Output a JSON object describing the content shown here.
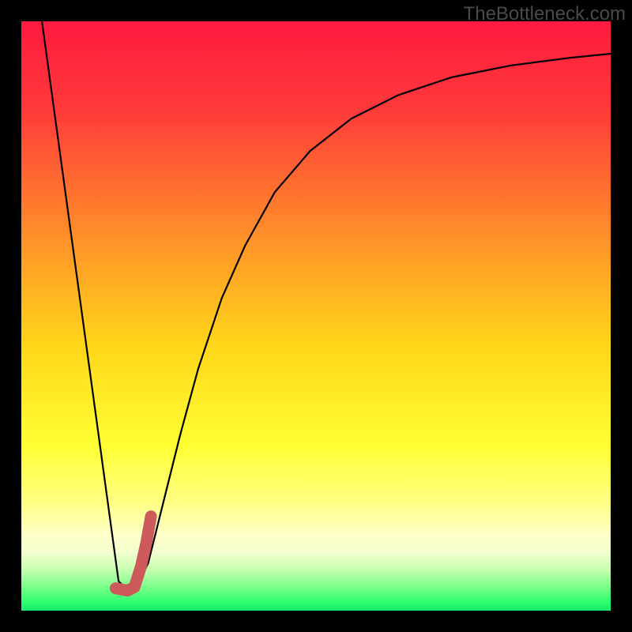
{
  "watermark": "TheBottleneck.com",
  "chart_data": {
    "type": "line",
    "title": "",
    "xlabel": "",
    "ylabel": "",
    "xlim": [
      0,
      100
    ],
    "ylim": [
      0,
      100
    ],
    "gradient_stops": [
      {
        "offset": 0,
        "color": "#ff1a3f"
      },
      {
        "offset": 0.15,
        "color": "#ff3a3a"
      },
      {
        "offset": 0.35,
        "color": "#ff8a2a"
      },
      {
        "offset": 0.55,
        "color": "#ffd61a"
      },
      {
        "offset": 0.72,
        "color": "#ffff33"
      },
      {
        "offset": 0.82,
        "color": "#ffff88"
      },
      {
        "offset": 0.87,
        "color": "#ffffc8"
      },
      {
        "offset": 0.9,
        "color": "#f4ffd0"
      },
      {
        "offset": 0.93,
        "color": "#c8ffb0"
      },
      {
        "offset": 0.96,
        "color": "#7aff8a"
      },
      {
        "offset": 0.985,
        "color": "#2fff70"
      },
      {
        "offset": 1.0,
        "color": "#16e86a"
      }
    ],
    "series": [
      {
        "name": "curve",
        "stroke": "#000000",
        "stroke_width": 2.2,
        "points": [
          {
            "x": 3.5,
            "y": 100
          },
          {
            "x": 16.5,
            "y": 5
          },
          {
            "x": 18.0,
            "y": 3.5
          },
          {
            "x": 19.5,
            "y": 4
          },
          {
            "x": 21.5,
            "y": 8
          },
          {
            "x": 24.0,
            "y": 18
          },
          {
            "x": 27.0,
            "y": 30
          },
          {
            "x": 30.0,
            "y": 41
          },
          {
            "x": 34.0,
            "y": 53
          },
          {
            "x": 38.0,
            "y": 62
          },
          {
            "x": 43.0,
            "y": 71
          },
          {
            "x": 49.0,
            "y": 78
          },
          {
            "x": 56.0,
            "y": 83.5
          },
          {
            "x": 64.0,
            "y": 87.5
          },
          {
            "x": 73.0,
            "y": 90.5
          },
          {
            "x": 83.0,
            "y": 92.5
          },
          {
            "x": 93.0,
            "y": 93.8
          },
          {
            "x": 100.0,
            "y": 94.5
          }
        ]
      },
      {
        "name": "marker",
        "stroke": "#cc5a5a",
        "stroke_width": 15,
        "linecap": "round",
        "points": [
          {
            "x": 16.0,
            "y": 3.8
          },
          {
            "x": 18.0,
            "y": 3.4
          },
          {
            "x": 19.2,
            "y": 4.0
          },
          {
            "x": 20.3,
            "y": 7.5
          },
          {
            "x": 21.2,
            "y": 11.5
          },
          {
            "x": 22.0,
            "y": 16.0
          }
        ]
      }
    ]
  }
}
